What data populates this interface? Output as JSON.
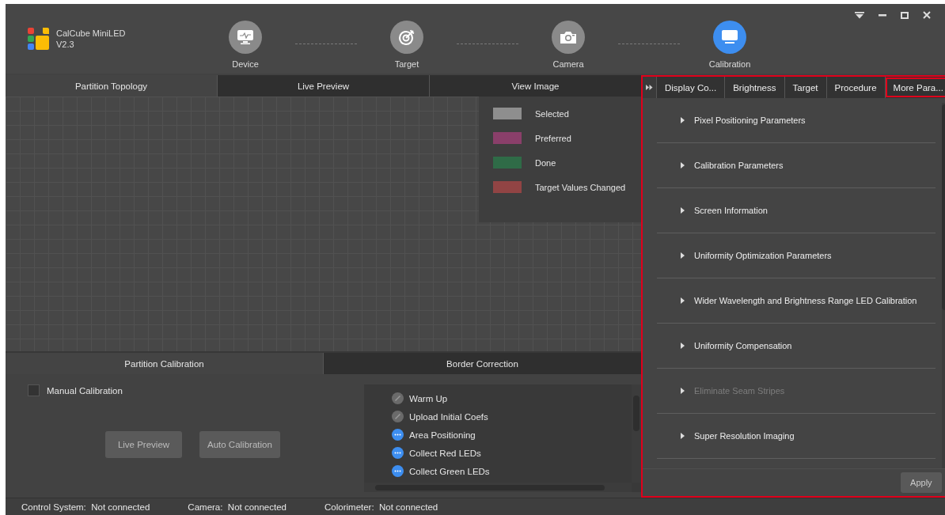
{
  "app": {
    "name": "CalCube MiniLED",
    "version": "V2.3"
  },
  "steps": [
    {
      "label": "Device",
      "selected": false
    },
    {
      "label": "Target",
      "selected": false
    },
    {
      "label": "Camera",
      "selected": false
    },
    {
      "label": "Calibration",
      "selected": true
    }
  ],
  "view_tabs": [
    {
      "label": "Partition Topology",
      "selected": true
    },
    {
      "label": "Live Preview",
      "selected": false
    },
    {
      "label": "View Image",
      "selected": false
    }
  ],
  "legend": [
    {
      "label": "Selected",
      "color": "#8e8e8e"
    },
    {
      "label": "Preferred",
      "color": "#8a3f6a"
    },
    {
      "label": "Done",
      "color": "#2f6b47"
    },
    {
      "label": "Target Values Changed",
      "color": "#914444"
    }
  ],
  "bottom_tabs": [
    {
      "label": "Partition Calibration",
      "selected": true
    },
    {
      "label": "Border Correction",
      "selected": false
    }
  ],
  "manual_calibration": {
    "label": "Manual Calibration",
    "checked": false
  },
  "buttons": [
    "Live Preview",
    "Auto Calibration"
  ],
  "procedure": [
    {
      "label": "Warm Up",
      "kind": "skipped"
    },
    {
      "label": "Upload Initial Coefs",
      "kind": "skipped"
    },
    {
      "label": "Area Positioning",
      "kind": "pending"
    },
    {
      "label": "Collect Red LEDs",
      "kind": "pending"
    },
    {
      "label": "Collect Green LEDs",
      "kind": "pending"
    }
  ],
  "panel_tabs": [
    {
      "label": "Display Co...",
      "selected": false
    },
    {
      "label": "Brightness",
      "selected": false
    },
    {
      "label": "Target",
      "selected": false
    },
    {
      "label": "Procedure",
      "selected": false
    },
    {
      "label": "More Para...",
      "selected": true
    }
  ],
  "sections": [
    {
      "label": "Pixel Positioning Parameters",
      "disabled": false
    },
    {
      "label": "Calibration Parameters",
      "disabled": false
    },
    {
      "label": "Screen Information",
      "disabled": false
    },
    {
      "label": "Uniformity Optimization Parameters",
      "disabled": false
    },
    {
      "label": "Wider Wavelength and Brightness Range LED Calibration",
      "disabled": false
    },
    {
      "label": "Uniformity Compensation",
      "disabled": false
    },
    {
      "label": "Eliminate Seam Stripes",
      "disabled": true
    },
    {
      "label": "Super Resolution Imaging",
      "disabled": false
    }
  ],
  "apply_button": "Apply",
  "status_bar": [
    {
      "label": "Control System:",
      "value": "Not connected"
    },
    {
      "label": "Camera:",
      "value": "Not connected"
    },
    {
      "label": "Colorimeter:",
      "value": "Not connected"
    }
  ]
}
